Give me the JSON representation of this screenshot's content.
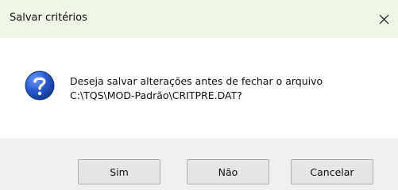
{
  "window": {
    "title": "Salvar critérios",
    "close_icon": "close-icon"
  },
  "message": {
    "icon": "question-icon",
    "line1": "Deseja salvar alterações antes de fechar o arquivo",
    "line2": "C:\\TQS\\MOD-Padrão\\CRITPRE.DAT?"
  },
  "buttons": {
    "yes_label": "Sim",
    "no_label": "Não",
    "cancel_label": "Cancelar"
  },
  "colors": {
    "titlebar_bg": "#eef6e6",
    "footer_bg": "#f0f0f0",
    "icon_blue": "#1f4fbf"
  }
}
